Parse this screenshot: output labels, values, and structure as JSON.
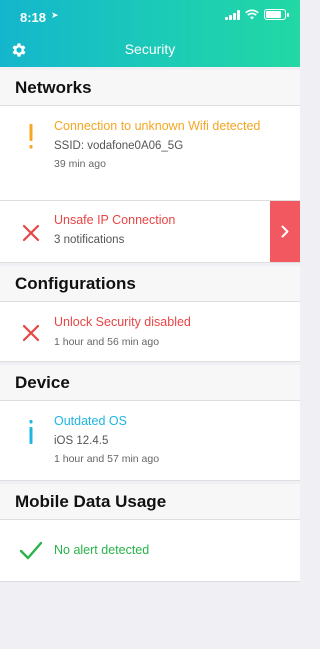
{
  "status_bar": {
    "time": "8:18",
    "location_glyph": "➤"
  },
  "header": {
    "title": "Security"
  },
  "sections": {
    "networks": {
      "title": "Networks",
      "wifi": {
        "title": "Connection to unknown Wifi detected",
        "ssid": "SSID: vodafone0A06_5G",
        "time": "39 min ago",
        "icon": "exclamation-icon"
      },
      "ip": {
        "title": "Unsafe IP Connection",
        "subtitle": "3 notifications",
        "icon": "x-icon"
      }
    },
    "configurations": {
      "title": "Configurations",
      "unlock": {
        "title": "Unlock Security disabled",
        "time": "1 hour and 56 min ago",
        "icon": "x-icon"
      }
    },
    "device": {
      "title": "Device",
      "os": {
        "title": "Outdated OS",
        "version": "iOS 12.4.5",
        "time": "1 hour and 57 min ago",
        "icon": "info-icon"
      }
    },
    "mobile_data": {
      "title": "Mobile Data Usage",
      "status": {
        "title": "No alert detected",
        "icon": "checkmark-icon"
      }
    }
  },
  "colors": {
    "header_start": "#14b6cd",
    "header_end": "#22d8a4",
    "warning": "#f5a623",
    "danger": "#e84545",
    "info": "#1fb6e0",
    "success": "#29b34a",
    "chevron_bg": "#f25860"
  }
}
